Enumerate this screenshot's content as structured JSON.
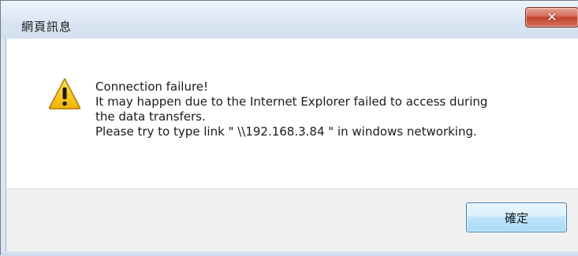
{
  "window": {
    "title": "網頁訊息",
    "close_label": "✕"
  },
  "message": {
    "lines": [
      "Connection failure!",
      "It may happen due to the Internet Explorer failed to access during",
      "the data transfers.",
      "Please try to type link \" \\\\192.168.3.84 \" in windows networking."
    ]
  },
  "icon": {
    "name": "warning-icon",
    "color": "#f5c400"
  },
  "buttons": {
    "ok_label": "確定"
  }
}
